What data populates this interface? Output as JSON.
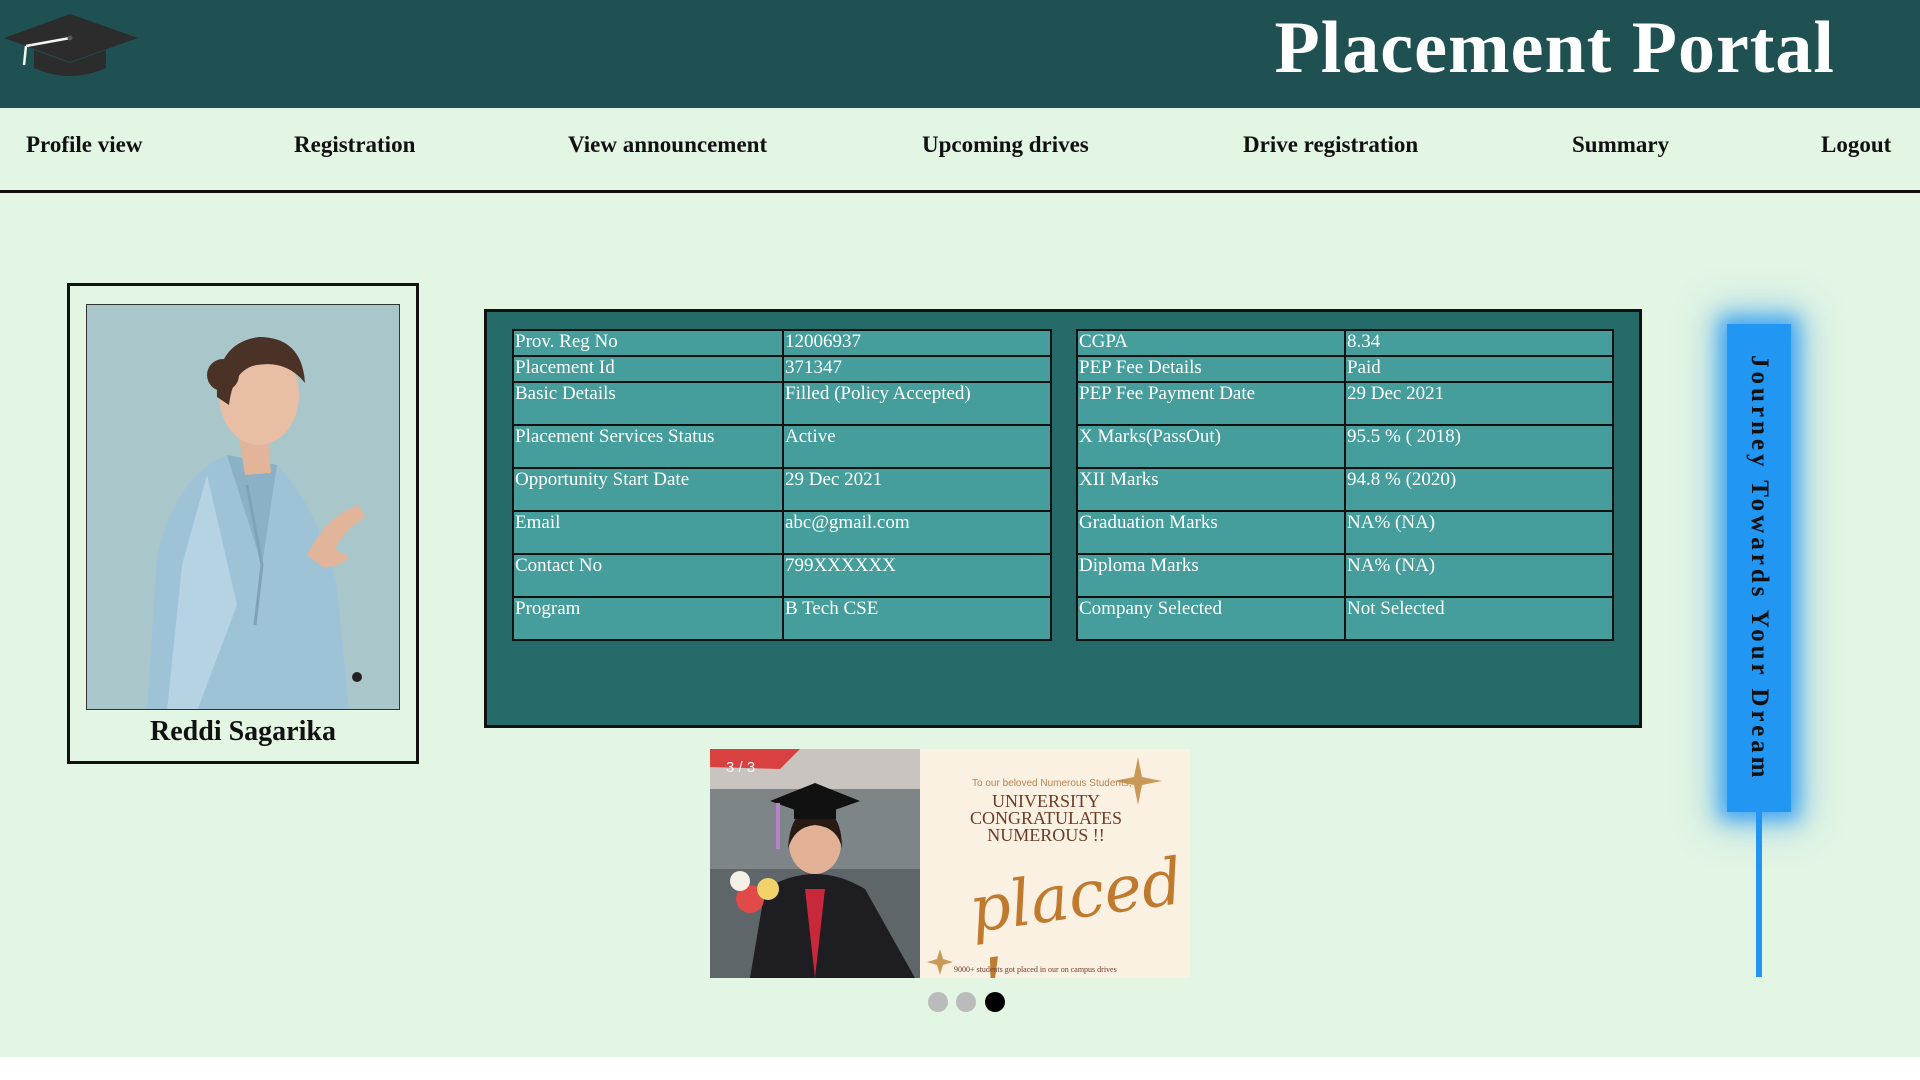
{
  "header": {
    "title": "Placement Portal"
  },
  "nav": {
    "items": [
      {
        "label": "Profile view"
      },
      {
        "label": "Registration"
      },
      {
        "label": "View announcement"
      },
      {
        "label": "Upcoming drives"
      },
      {
        "label": "Drive registration"
      },
      {
        "label": "Summary"
      },
      {
        "label": "Logout"
      }
    ]
  },
  "profile": {
    "name": "Reddi Sagarika"
  },
  "details": {
    "left": [
      {
        "label": "Prov. Reg No",
        "value": "12006937"
      },
      {
        "label": "Placement Id",
        "value": "371347"
      },
      {
        "label": "Basic Details",
        "value": "Filled (Policy Accepted)"
      },
      {
        "label": "Placement Services Status",
        "value": "Active"
      },
      {
        "label": "Opportunity Start Date",
        "value": "29 Dec 2021"
      },
      {
        "label": "Email",
        "value": "abc@gmail.com"
      },
      {
        "label": "Contact No",
        "value": "799XXXXXX"
      },
      {
        "label": "Program",
        "value": "B Tech CSE"
      }
    ],
    "right": [
      {
        "label": "CGPA",
        "value": "8.34"
      },
      {
        "label": "PEP Fee Details",
        "value": "Paid"
      },
      {
        "label": "PEP Fee Payment Date",
        "value": "29 Dec 2021"
      },
      {
        "label": "X Marks(PassOut)",
        "value": "95.5 % ( 2018)"
      },
      {
        "label": "XII Marks",
        "value": "94.8 % (2020)"
      },
      {
        "label": "Graduation Marks",
        "value": "NA% (NA)"
      },
      {
        "label": "Diploma Marks",
        "value": "NA% (NA)"
      },
      {
        "label": "Company Selected",
        "value": "Not Selected"
      }
    ]
  },
  "slideshow": {
    "counter": "3 / 3",
    "slide": {
      "dedication": "To our beloved Numerous Students,",
      "headline_line1": "UNIVERSITY",
      "headline_line2": "CONGRATULATES",
      "headline_line3": "NUMEROUS !!",
      "script_text": "placed !",
      "footnote": "9000+ students got placed in our on campus drives"
    },
    "dots": 3,
    "active_dot": 3
  },
  "sidebar": {
    "tagline": "Journey Towards Your Dream"
  },
  "colors": {
    "header_bg": "#1f5152",
    "page_bg": "#e3f5e3",
    "panel_bg": "#246b6a",
    "cell_bg": "#459e9b",
    "accent_blue": "#2196f3"
  }
}
